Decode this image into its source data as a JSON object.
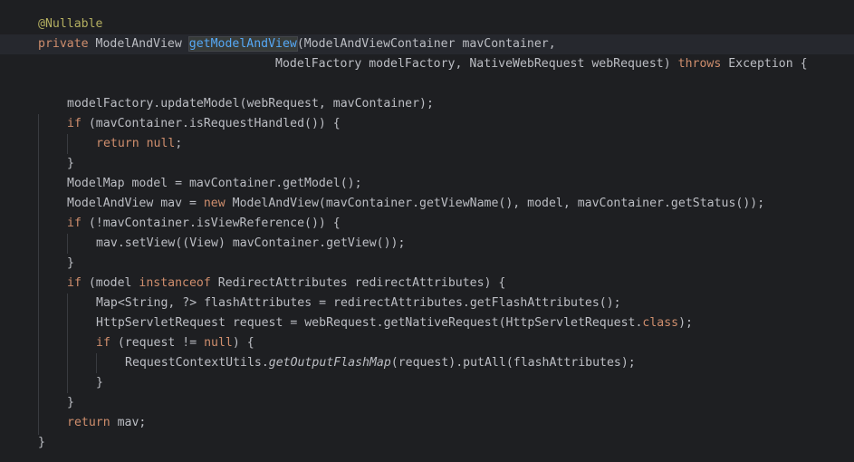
{
  "editor": {
    "lines": [
      {
        "indent": 0,
        "tokens": [
          {
            "t": "@Nullable",
            "c": "ann"
          }
        ]
      },
      {
        "indent": 0,
        "current": true,
        "tokens": [
          {
            "t": "private ",
            "c": "kw"
          },
          {
            "t": "ModelAndView "
          },
          {
            "t": "getModelAndView",
            "c": "fn-sel"
          },
          {
            "t": "(ModelAndViewContainer mavContainer,"
          }
        ]
      },
      {
        "indent": 0,
        "tokens": [
          {
            "t": "                                 ModelFactory modelFactory, NativeWebRequest webRequest) "
          },
          {
            "t": "throws ",
            "c": "kw"
          },
          {
            "t": "Exception {"
          }
        ]
      },
      {
        "indent": 0,
        "tokens": []
      },
      {
        "indent": 1,
        "tokens": [
          {
            "t": "modelFactory.updateModel(webRequest, mavContainer);"
          }
        ]
      },
      {
        "indent": 1,
        "tokens": [
          {
            "t": "if ",
            "c": "kw"
          },
          {
            "t": "(mavContainer.isRequestHandled()) {"
          }
        ]
      },
      {
        "indent": 2,
        "tokens": [
          {
            "t": "return ",
            "c": "kw"
          },
          {
            "t": "null",
            "c": "kw"
          },
          {
            "t": ";"
          }
        ]
      },
      {
        "indent": 1,
        "tokens": [
          {
            "t": "}"
          }
        ]
      },
      {
        "indent": 1,
        "tokens": [
          {
            "t": "ModelMap model = mavContainer.getModel();"
          }
        ]
      },
      {
        "indent": 1,
        "tokens": [
          {
            "t": "ModelAndView mav = "
          },
          {
            "t": "new ",
            "c": "kw"
          },
          {
            "t": "ModelAndView(mavContainer.getViewName(), model, mavContainer.getStatus());"
          }
        ]
      },
      {
        "indent": 1,
        "tokens": [
          {
            "t": "if ",
            "c": "kw"
          },
          {
            "t": "(!mavContainer.isViewReference()) {"
          }
        ]
      },
      {
        "indent": 2,
        "tokens": [
          {
            "t": "mav.setView((View) mavContainer.getView());"
          }
        ]
      },
      {
        "indent": 1,
        "tokens": [
          {
            "t": "}"
          }
        ]
      },
      {
        "indent": 1,
        "tokens": [
          {
            "t": "if ",
            "c": "kw"
          },
          {
            "t": "(model "
          },
          {
            "t": "instanceof ",
            "c": "kw"
          },
          {
            "t": "RedirectAttributes redirectAttributes) {"
          }
        ]
      },
      {
        "indent": 2,
        "tokens": [
          {
            "t": "Map<String, ?> flashAttributes = redirectAttributes.getFlashAttributes();"
          }
        ]
      },
      {
        "indent": 2,
        "tokens": [
          {
            "t": "HttpServletRequest request = webRequest.getNativeRequest(HttpServletRequest."
          },
          {
            "t": "class",
            "c": "kw"
          },
          {
            "t": ");"
          }
        ]
      },
      {
        "indent": 2,
        "tokens": [
          {
            "t": "if ",
            "c": "kw"
          },
          {
            "t": "(request != "
          },
          {
            "t": "null",
            "c": "kw"
          },
          {
            "t": ") {"
          }
        ]
      },
      {
        "indent": 3,
        "tokens": [
          {
            "t": "RequestContextUtils."
          },
          {
            "t": "getOutputFlashMap",
            "c": "it"
          },
          {
            "t": "(request).putAll(flashAttributes);"
          }
        ]
      },
      {
        "indent": 2,
        "tokens": [
          {
            "t": "}"
          }
        ]
      },
      {
        "indent": 1,
        "tokens": [
          {
            "t": "}"
          }
        ]
      },
      {
        "indent": 1,
        "tokens": [
          {
            "t": "return ",
            "c": "kw"
          },
          {
            "t": "mav;"
          }
        ]
      },
      {
        "indent": 0,
        "tokens": [
          {
            "t": "}"
          }
        ]
      }
    ]
  }
}
